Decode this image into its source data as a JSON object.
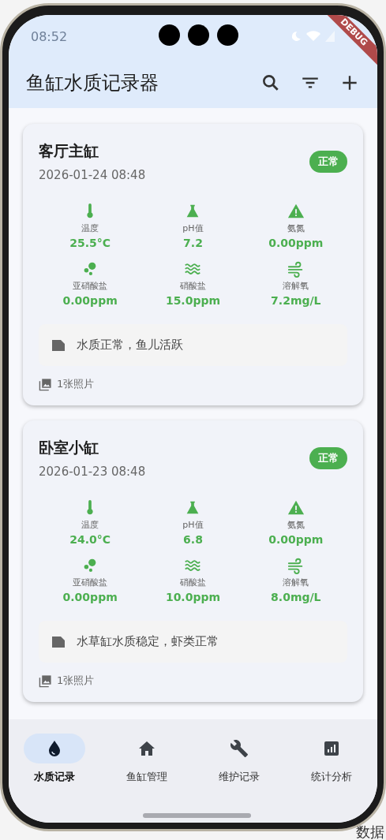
{
  "status_bar": {
    "time": "08:52"
  },
  "debug_banner": "DEBUG",
  "app_bar": {
    "title": "鱼缸水质记录器"
  },
  "records": [
    {
      "tank": "客厅主缸",
      "datetime": "2026-01-24 08:48",
      "status": "正常",
      "metrics": [
        {
          "kind": "temperature",
          "label": "温度",
          "value": "25.5°C"
        },
        {
          "kind": "ph",
          "label": "pH值",
          "value": "7.2"
        },
        {
          "kind": "ammonia",
          "label": "氨氮",
          "value": "0.00ppm"
        },
        {
          "kind": "nitrite",
          "label": "亚硝酸盐",
          "value": "0.00ppm"
        },
        {
          "kind": "nitrate",
          "label": "硝酸盐",
          "value": "15.0ppm"
        },
        {
          "kind": "oxygen",
          "label": "溶解氧",
          "value": "7.2mg/L"
        }
      ],
      "note": "水质正常，鱼儿活跃",
      "photos": "1张照片"
    },
    {
      "tank": "卧室小缸",
      "datetime": "2026-01-23 08:48",
      "status": "正常",
      "metrics": [
        {
          "kind": "temperature",
          "label": "温度",
          "value": "24.0°C"
        },
        {
          "kind": "ph",
          "label": "pH值",
          "value": "6.8"
        },
        {
          "kind": "ammonia",
          "label": "氨氮",
          "value": "0.00ppm"
        },
        {
          "kind": "nitrite",
          "label": "亚硝酸盐",
          "value": "0.00ppm"
        },
        {
          "kind": "nitrate",
          "label": "硝酸盐",
          "value": "10.0ppm"
        },
        {
          "kind": "oxygen",
          "label": "溶解氧",
          "value": "8.0mg/L"
        }
      ],
      "note": "水草缸水质稳定，虾类正常",
      "photos": "1张照片"
    }
  ],
  "nav": [
    {
      "kind": "drop",
      "label": "水质记录",
      "selected": true
    },
    {
      "kind": "home",
      "label": "鱼缸管理",
      "selected": false
    },
    {
      "kind": "wrench",
      "label": "维护记录",
      "selected": false
    },
    {
      "kind": "chart",
      "label": "统计分析",
      "selected": false
    }
  ],
  "background_text": "数据"
}
